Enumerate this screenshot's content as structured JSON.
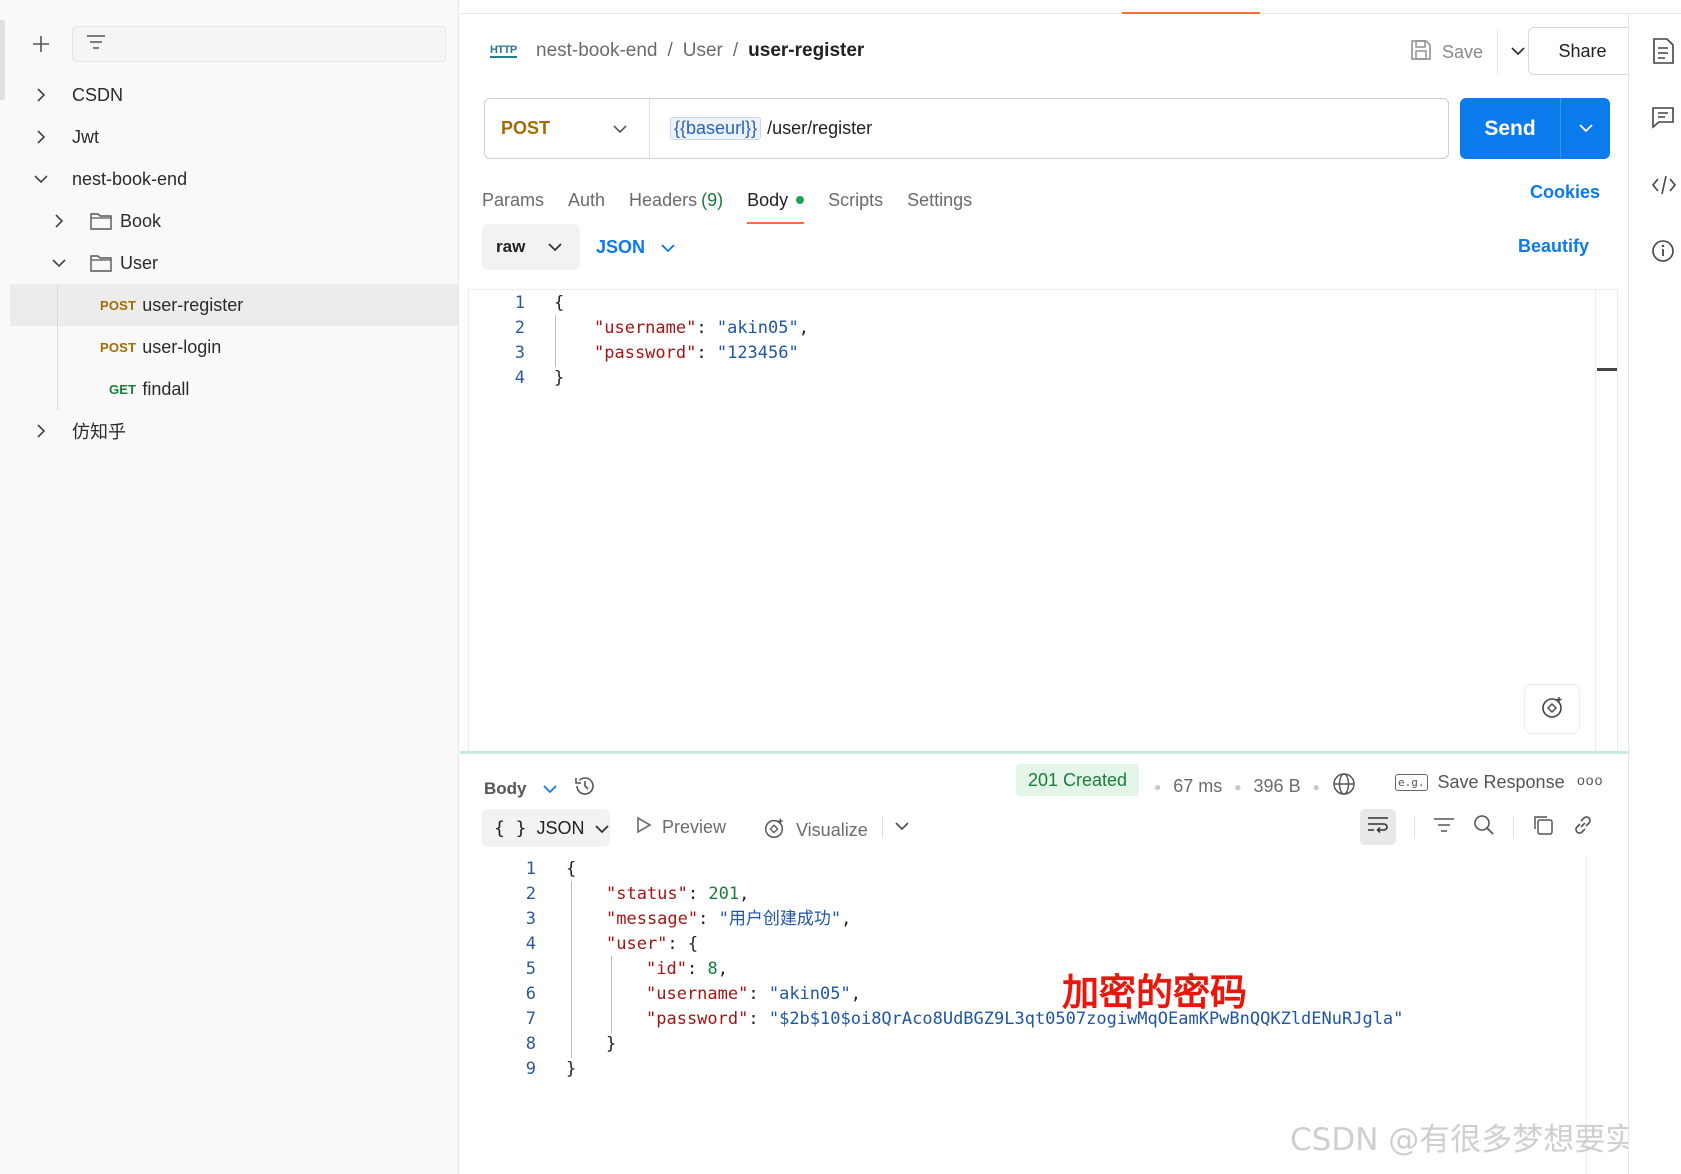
{
  "sidebar": {
    "items": [
      {
        "label": "CSDN"
      },
      {
        "label": "Jwt"
      },
      {
        "label": "nest-book-end"
      },
      {
        "label": "Book"
      },
      {
        "label": "User"
      },
      {
        "method": "POST",
        "label": "user-register"
      },
      {
        "method": "POST",
        "label": "user-login"
      },
      {
        "method": "GET",
        "label": "findall"
      },
      {
        "label": "仿知乎"
      }
    ]
  },
  "header": {
    "http_badge": "HTTP",
    "breadcrumb": [
      "nest-book-end",
      "/",
      "User",
      "/",
      "user-register"
    ],
    "save_label": "Save",
    "share_label": "Share"
  },
  "request": {
    "method": "POST",
    "url_variable": "{{baseurl}}",
    "url_path": "/user/register",
    "send_label": "Send",
    "tabs": {
      "params": "Params",
      "auth": "Auth",
      "headers": "Headers",
      "headers_count": "(9)",
      "body": "Body",
      "scripts": "Scripts",
      "settings": "Settings"
    },
    "cookies_label": "Cookies",
    "body_mode": "raw",
    "body_format": "JSON",
    "beautify_label": "Beautify",
    "body_lines": [
      {
        "num": "1",
        "indent": 0,
        "tokens": [
          {
            "t": "{",
            "c": "p"
          }
        ]
      },
      {
        "num": "2",
        "indent": 1,
        "tokens": [
          {
            "t": "\"username\"",
            "c": "k"
          },
          {
            "t": ": ",
            "c": "p"
          },
          {
            "t": "\"akin05\"",
            "c": "s"
          },
          {
            "t": ",",
            "c": "p"
          }
        ]
      },
      {
        "num": "3",
        "indent": 1,
        "tokens": [
          {
            "t": "\"password\"",
            "c": "k"
          },
          {
            "t": ": ",
            "c": "p"
          },
          {
            "t": "\"123456\"",
            "c": "s"
          }
        ]
      },
      {
        "num": "4",
        "indent": 0,
        "tokens": [
          {
            "t": "}",
            "c": "p"
          }
        ]
      }
    ]
  },
  "response": {
    "body_label": "Body",
    "status": "201 Created",
    "time": "67 ms",
    "size": "396 B",
    "save_response_label": "Save Response",
    "eg_badge": "e.g.",
    "more": "ooo",
    "format_label": "JSON",
    "format_braces": "{ }",
    "preview_label": "Preview",
    "visualize_label": "Visualize",
    "lines": [
      {
        "num": "1",
        "indent": 0,
        "tokens": [
          {
            "t": "{",
            "c": "p"
          }
        ]
      },
      {
        "num": "2",
        "indent": 1,
        "tokens": [
          {
            "t": "\"status\"",
            "c": "k"
          },
          {
            "t": ": ",
            "c": "p"
          },
          {
            "t": "201",
            "c": "n"
          },
          {
            "t": ",",
            "c": "p"
          }
        ]
      },
      {
        "num": "3",
        "indent": 1,
        "tokens": [
          {
            "t": "\"message\"",
            "c": "k"
          },
          {
            "t": ": ",
            "c": "p"
          },
          {
            "t": "\"用户创建成功\"",
            "c": "s"
          },
          {
            "t": ",",
            "c": "p"
          }
        ]
      },
      {
        "num": "4",
        "indent": 1,
        "tokens": [
          {
            "t": "\"user\"",
            "c": "k"
          },
          {
            "t": ": {",
            "c": "p"
          }
        ]
      },
      {
        "num": "5",
        "indent": 2,
        "tokens": [
          {
            "t": "\"id\"",
            "c": "k"
          },
          {
            "t": ": ",
            "c": "p"
          },
          {
            "t": "8",
            "c": "n"
          },
          {
            "t": ",",
            "c": "p"
          }
        ]
      },
      {
        "num": "6",
        "indent": 2,
        "tokens": [
          {
            "t": "\"username\"",
            "c": "k"
          },
          {
            "t": ": ",
            "c": "p"
          },
          {
            "t": "\"akin05\"",
            "c": "s"
          },
          {
            "t": ",",
            "c": "p"
          }
        ]
      },
      {
        "num": "7",
        "indent": 2,
        "tokens": [
          {
            "t": "\"password\"",
            "c": "k"
          },
          {
            "t": ": ",
            "c": "p"
          },
          {
            "t": "\"$2b$10$oi8QrAco8UdBGZ9L3qt0507zogiwMqOEamKPwBnQQKZldENuRJgla\"",
            "c": "s"
          }
        ]
      },
      {
        "num": "8",
        "indent": 1,
        "tokens": [
          {
            "t": "}",
            "c": "p"
          }
        ]
      },
      {
        "num": "9",
        "indent": 0,
        "tokens": [
          {
            "t": "}",
            "c": "p"
          }
        ]
      }
    ]
  },
  "annotation": "加密的密码",
  "watermark": "CSDN @有很多梦想要实现",
  "colors": {
    "accent": "#097bed",
    "method_post": "#a56b00",
    "method_get": "#1a7d3b",
    "active_tab": "#ff6c37",
    "status_bg": "#e3f5e9",
    "annotation": "#e8160c"
  }
}
